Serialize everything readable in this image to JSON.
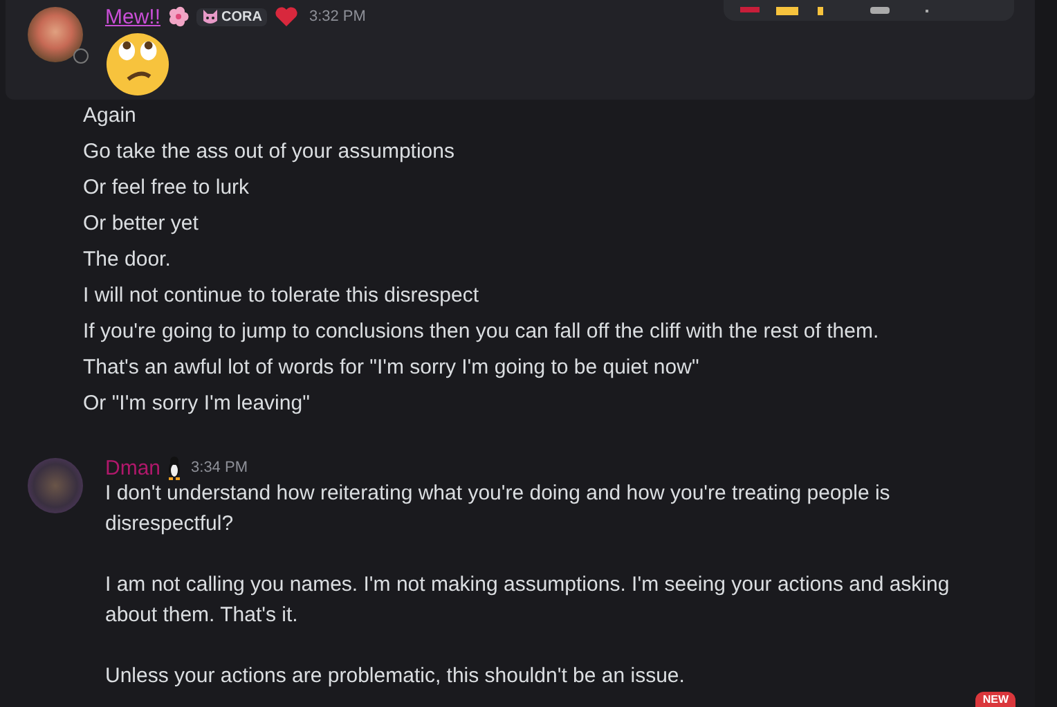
{
  "messages": [
    {
      "kind": "emoji_message",
      "author": "Mew!!",
      "role_tag": "CORA",
      "time": "3:32 PM",
      "hovered": true
    },
    {
      "kind": "continuation",
      "lines": [
        "Again",
        "Go take the ass out of your assumptions",
        "Or feel free to lurk",
        "Or better yet",
        "The door.",
        "I will not continue to tolerate this disrespect",
        "If you're going to jump to conclusions then you can fall off the cliff with the rest of them.",
        "That's an awful lot of words for \"I'm sorry I'm going to be quiet now\"",
        "Or \"I'm sorry I'm leaving\""
      ]
    },
    {
      "kind": "text_message",
      "author": "Dman",
      "time": "3:34 PM",
      "paragraphs": [
        "I don't understand how reiterating what you're doing and how you're treating people is disrespectful?",
        "I am not calling you names. I'm not making assumptions. I'm seeing your actions and asking about them. That's it.",
        "Unless your actions are problematic, this shouldn't be an issue."
      ]
    }
  ],
  "new_badge": "NEW"
}
